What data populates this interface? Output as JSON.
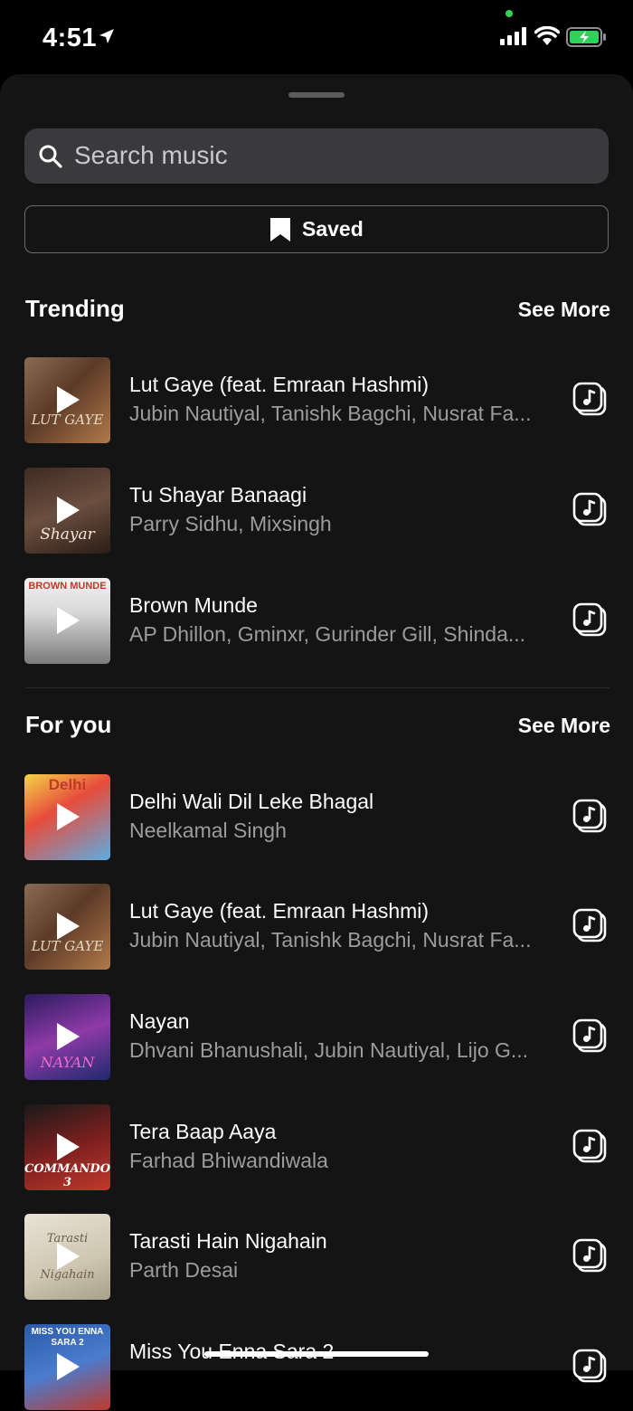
{
  "status": {
    "time": "4:51"
  },
  "search": {
    "placeholder": "Search music"
  },
  "saved": {
    "label": "Saved"
  },
  "trending": {
    "title": "Trending",
    "see_more": "See More",
    "tracks": [
      {
        "title": "Lut Gaye (feat. Emraan Hashmi)",
        "artist": "Jubin Nautiyal, Tanishk Bagchi, Nusrat Fa...",
        "cover_text": "LUT GAYE"
      },
      {
        "title": "Tu Shayar Banaagi",
        "artist": "Parry Sidhu, Mixsingh",
        "cover_text": "Shayar"
      },
      {
        "title": "Brown Munde",
        "artist": "AP Dhillon, Gminxr, Gurinder Gill, Shinda...",
        "cover_text": "BROWN MUNDE"
      }
    ]
  },
  "for_you": {
    "title": "For you",
    "see_more": "See More",
    "tracks": [
      {
        "title": "Delhi Wali Dil Leke Bhagal",
        "artist": "Neelkamal Singh",
        "cover_text": "Delhi"
      },
      {
        "title": "Lut Gaye (feat. Emraan Hashmi)",
        "artist": "Jubin Nautiyal, Tanishk Bagchi, Nusrat Fa...",
        "cover_text": "LUT GAYE"
      },
      {
        "title": "Nayan",
        "artist": "Dhvani Bhanushali, Jubin Nautiyal, Lijo G...",
        "cover_text": "NAYAN"
      },
      {
        "title": "Tera Baap Aaya",
        "artist": "Farhad Bhiwandiwala",
        "cover_text": "COMMANDO 3"
      },
      {
        "title": "Tarasti Hain Nigahain",
        "artist": "Parth Desai",
        "cover_text": "Tarasti Nigahain"
      },
      {
        "title": "Miss You Enna Sara 2",
        "artist": "",
        "cover_text": "MISS YOU ENNA SARA 2"
      }
    ]
  },
  "colors": {
    "sheet_bg": "#141414",
    "search_bg": "#3a3a3c",
    "secondary_text": "#9c9c9f",
    "battery_green": "#30d158"
  },
  "icons": [
    "location-arrow-icon",
    "signal-icon",
    "wifi-icon",
    "battery-charging-icon",
    "search-icon",
    "bookmark-icon",
    "play-icon",
    "use-in-reel-icon"
  ]
}
